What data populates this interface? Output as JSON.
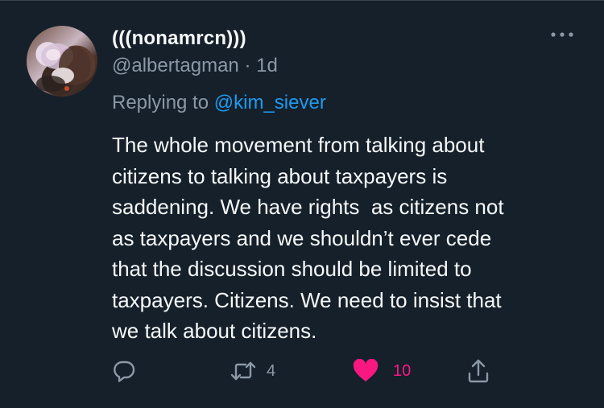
{
  "author": {
    "display_name": "(((nonamrcn)))",
    "meta": "@albertagman · 1d"
  },
  "reply": {
    "prefix": "Replying to ",
    "mention": "@kim_siever"
  },
  "tweet": {
    "lines": [
      "The whole movement from talking about",
      "citizens to talking about taxpayers is",
      "saddening. We have rights  as citizens not",
      "as taxpayers and we shouldn’t ever cede",
      "that the discussion should be limited to",
      "taxpayers. Citizens. We need to insist that",
      "we talk about citizens."
    ]
  },
  "actions": {
    "reply_icon": "reply-icon",
    "retweet_icon": "retweet-icon",
    "retweet_count": "4",
    "like_icon": "heart-filled-icon",
    "like_count": "10",
    "share_icon": "share-icon"
  },
  "colors": {
    "background": "#15202b",
    "text_primary": "#f7f9f9",
    "text_secondary": "#8b98a5",
    "link": "#1d9bf0",
    "like": "#f91880"
  }
}
